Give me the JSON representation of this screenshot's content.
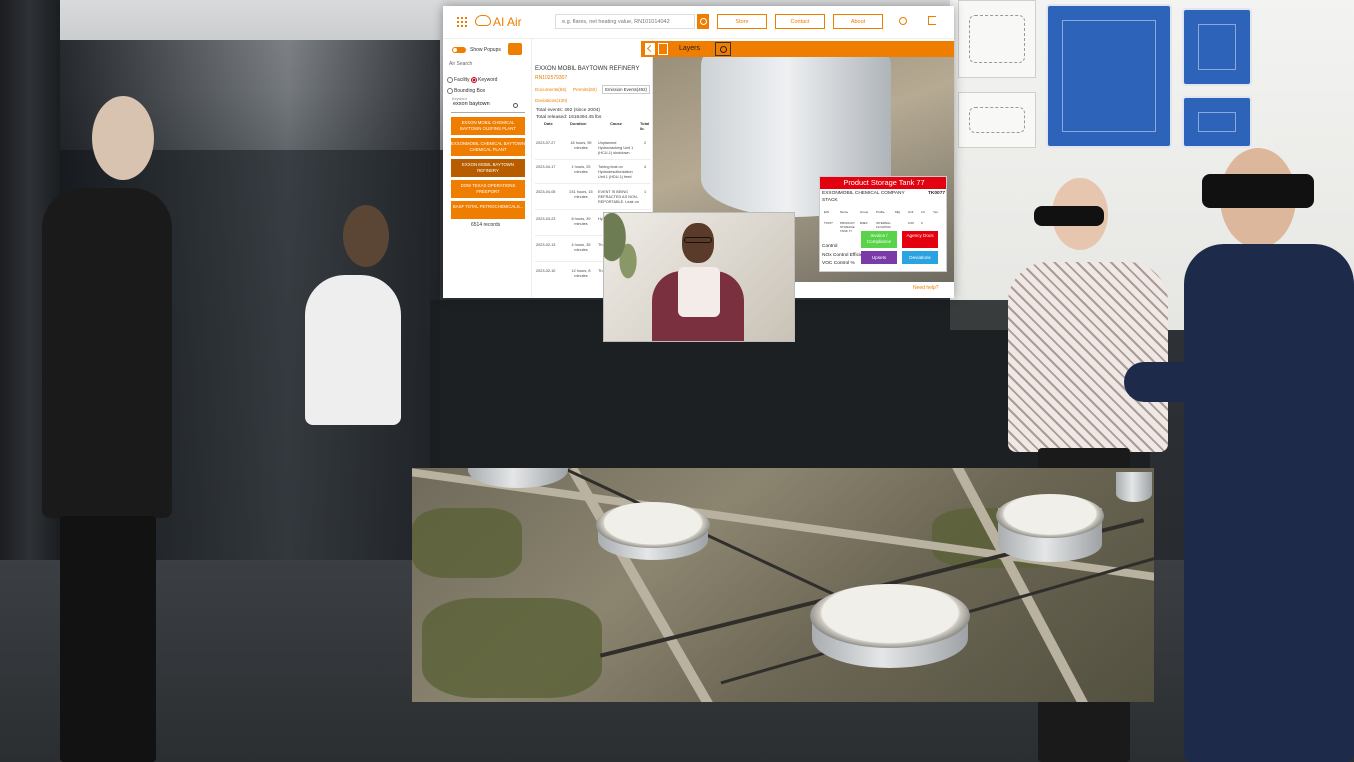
{
  "app": {
    "brand": "AI Air",
    "search_placeholder": "e.g. flares, net heating value, RN101014042",
    "nav": [
      "Store",
      "Contact",
      "About"
    ]
  },
  "search_panel": {
    "show_popups": "Show Popups",
    "air_search": "Air Search",
    "facility": "Facility",
    "keyword": "Keyword",
    "bounding_box": "Bounding Box",
    "keyword_label": "Keyword",
    "keyword_value": "exxon baytown",
    "results": [
      "EXXON MOBIL CHEMICAL BAYTOWN OLEFINS PLANT",
      "EXXONMOBIL CHEMICAL BAYTOWN CHEMICAL PLANT",
      "EXXON MOBIL BAYTOWN REFINERY",
      "DOW TEXAS OPERATIONS FREEPORT",
      "BASF TOTAL PETROCHEMICALS..."
    ],
    "records": "6514 records"
  },
  "facility_panel": {
    "title": "EXXON MOBIL BAYTOWN REFINERY",
    "id": "RN102579307",
    "tabs": [
      "Documents(56)",
      "Permits(60)",
      "Emission Events(492)",
      "Deviations(130)"
    ],
    "total_events": "Total events: 492 (since 2004)",
    "total_released": "Total released: 1616494.45 lbs",
    "columns": [
      "Date",
      "Duration",
      "Cause",
      "Total lb."
    ],
    "rows": [
      {
        "date": "2023-07-27",
        "duration": "18 hours, 59 minutes",
        "cause": "Unplanned Hydrocracking Unit 1 (HCU-1) shutdown",
        "total": "2"
      },
      {
        "date": "2023-04-17",
        "duration": "1 hours, 25 minutes",
        "cause": "Tubing leak on Hydrodesulfurization Unit 1 (HDU-1) feed",
        "total": "4"
      },
      {
        "date": "2023-04-05",
        "duration": "241 hours, 15 minutes",
        "cause": "EVENT IS BEING REFRACTED AS NON-REPORTABLE. Leak on",
        "total": "1"
      },
      {
        "date": "2023-03-23",
        "duration": "8 hours, 39 minutes",
        "cause": "Hy... hy...",
        "total": ""
      },
      {
        "date": "2023-02-13",
        "duration": "4 hours, 35 minutes",
        "cause": "Th... ac... af...",
        "total": ""
      },
      {
        "date": "2023-02-10",
        "duration": "12 hours, 8 minutes",
        "cause": "Th... Un... ca...",
        "total": ""
      }
    ]
  },
  "map": {
    "layers": "Layers",
    "need_help": "Need help?"
  },
  "popup": {
    "title": "Product Storage Tank 77",
    "company": "EXXONMOBIL CHEMICAL COMPANY",
    "tank_id": "TK0077",
    "type": "STACK",
    "headers": [
      "EIN",
      "Name",
      "Group",
      "Profile",
      "Mfg",
      "Unit",
      "LO",
      "Yes"
    ],
    "cells": [
      "TK077",
      "PRODUCT STORAGE TANK 77",
      "B4EX",
      "INTERNAL FLOATING",
      "",
      "0.00",
      "0",
      ""
    ],
    "labels": [
      "Control",
      "NOx Control Efficie",
      "VOC Control %"
    ],
    "buttons": {
      "invoice": "Invoice / Compliance",
      "agency": "Agency Docs",
      "upsets": "Upsets",
      "deviations": "Deviations"
    },
    "colors": {
      "header": "#e3000f",
      "invoice": "#59d44a",
      "agency": "#e3000f",
      "upsets": "#7a3aa8",
      "deviations": "#2aa3e0"
    }
  },
  "theme": {
    "accent": "#ef7d00"
  }
}
